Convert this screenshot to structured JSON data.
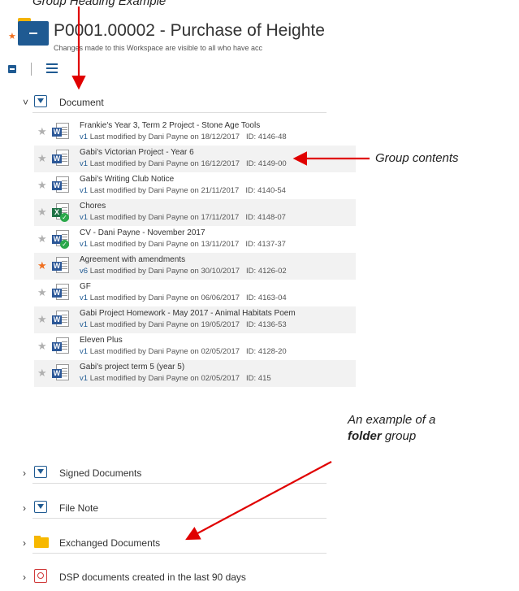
{
  "top_caption": "Group Heading Example",
  "header": {
    "title": "P0001.00002 - Purchase of Heighte",
    "subtitle": "Changes made to this Workspace are visible to all who have acc"
  },
  "groups": {
    "document": {
      "label": "Document",
      "chevron": "˅",
      "icon": "document-group-icon",
      "expanded": true
    },
    "signed": {
      "label": "Signed Documents",
      "chevron": "›",
      "icon": "document-group-icon"
    },
    "filenote": {
      "label": "File Note",
      "chevron": "›",
      "icon": "document-group-icon"
    },
    "exchanged": {
      "label": "Exchanged Documents",
      "chevron": "›",
      "icon": "folder-icon"
    },
    "dsp": {
      "label": "DSP documents created in the last 90 days",
      "chevron": "›",
      "icon": "search-folder-icon"
    }
  },
  "documents": [
    {
      "name": "Frankie's Year 3, Term 2 Project - Stone Age Tools",
      "version": "v1",
      "meta": "Last modified by Dani Payne on 18/12/2017",
      "id": "ID: 4146-48",
      "type": "word",
      "badge": "W",
      "favorite": false,
      "checked": false
    },
    {
      "name": "Gabi's Victorian Project - Year 6",
      "version": "v1",
      "meta": "Last modified by Dani Payne on 16/12/2017",
      "id": "ID: 4149-00",
      "type": "word",
      "badge": "W",
      "favorite": false,
      "checked": false
    },
    {
      "name": "Gabi's Writing Club Notice",
      "version": "v1",
      "meta": "Last modified by Dani Payne on 21/11/2017",
      "id": "ID: 4140-54",
      "type": "word",
      "badge": "W",
      "favorite": false,
      "checked": false
    },
    {
      "name": "Chores",
      "version": "v1",
      "meta": "Last modified by Dani Payne on 17/11/2017",
      "id": "ID: 4148-07",
      "type": "excel",
      "badge": "X",
      "favorite": false,
      "checked": true
    },
    {
      "name": "CV - Dani Payne - November 2017",
      "version": "v1",
      "meta": "Last modified by Dani Payne on 13/11/2017",
      "id": "ID: 4137-37",
      "type": "word",
      "badge": "W",
      "favorite": false,
      "checked": true
    },
    {
      "name": "Agreement with amendments",
      "version": "v6",
      "meta": "Last modified by Dani Payne on 30/10/2017",
      "id": "ID: 4126-02",
      "type": "word",
      "badge": "W",
      "favorite": true,
      "checked": false
    },
    {
      "name": "GF",
      "version": "v1",
      "meta": "Last modified by Dani Payne on 06/06/2017",
      "id": "ID: 4163-04",
      "type": "word",
      "badge": "W",
      "favorite": false,
      "checked": false
    },
    {
      "name": "Gabi Project Homework - May 2017 - Animal Habitats Poem",
      "version": "v1",
      "meta": "Last modified by Dani Payne on 19/05/2017",
      "id": "ID: 4136-53",
      "type": "word",
      "badge": "W",
      "favorite": false,
      "checked": false
    },
    {
      "name": "Eleven Plus",
      "version": "v1",
      "meta": "Last modified by Dani Payne on 02/05/2017",
      "id": "ID: 4128-20",
      "type": "word",
      "badge": "W",
      "favorite": false,
      "checked": false
    },
    {
      "name": "Gabi's project term 5 (year 5)",
      "version": "v1",
      "meta": "Last modified by Dani Payne on 02/05/2017",
      "id": "ID: 415",
      "type": "word",
      "badge": "W",
      "favorite": false,
      "checked": false
    }
  ],
  "annotations": {
    "group_contents": "Group contents",
    "folder_line1": "An example of a",
    "folder_line2_bold": "folder",
    "folder_line2_rest": " group"
  },
  "colors": {
    "accent": "#1f5a92",
    "favorite": "#f07020",
    "arrow": "#e00000",
    "folder": "#f4b300"
  },
  "icons": {
    "star": "★",
    "checkmark": "✓"
  }
}
